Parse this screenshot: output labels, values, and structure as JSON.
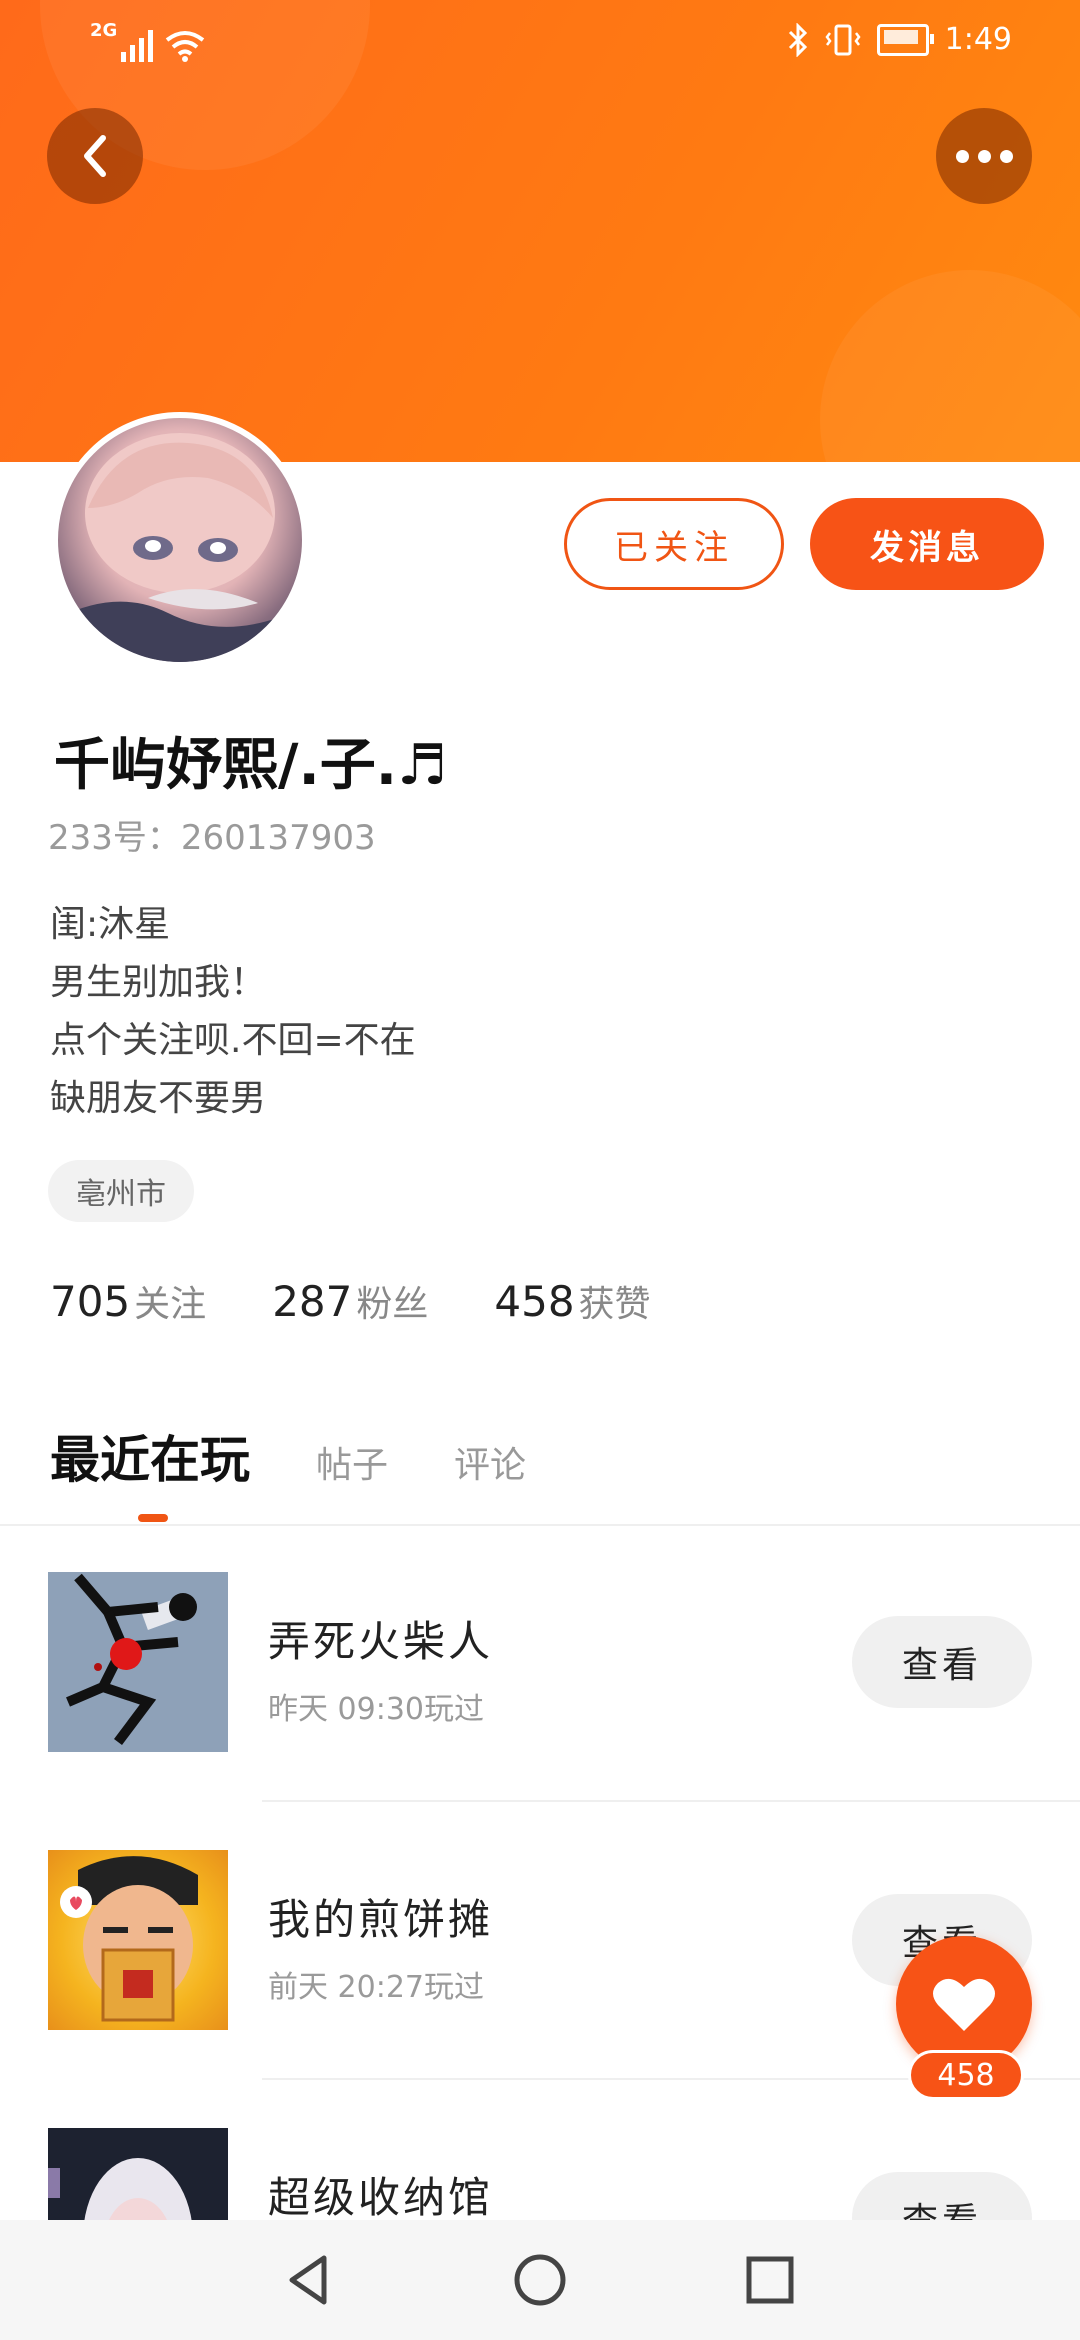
{
  "status_bar": {
    "network": "2G",
    "time": "1:49"
  },
  "profile": {
    "username": "千屿妤熙/.子.♬",
    "id_label": "233号：",
    "id_value": "260137903",
    "bio": [
      "闺:沐星",
      "男生别加我！",
      "点个关注呗.不回=不在",
      "缺朋友不要男"
    ],
    "location": "亳州市",
    "buttons": {
      "followed": "已关注",
      "message": "发消息"
    },
    "stats": [
      {
        "num": "705",
        "label": "关注"
      },
      {
        "num": "287",
        "label": "粉丝"
      },
      {
        "num": "458",
        "label": "获赞"
      }
    ]
  },
  "tabs": [
    "最近在玩",
    "帖子",
    "评论"
  ],
  "games": [
    {
      "title": "弄死火柴人",
      "subtitle": "昨天 09:30玩过",
      "action": "查看"
    },
    {
      "title": "我的煎饼摊",
      "subtitle": "前天 20:27玩过",
      "action": "查看"
    },
    {
      "title": "超级收纳馆",
      "subtitle": "",
      "action": "查看"
    }
  ],
  "like_fab": {
    "count": "458"
  },
  "colors": {
    "accent": "#f75316",
    "header": "#ff7412"
  }
}
